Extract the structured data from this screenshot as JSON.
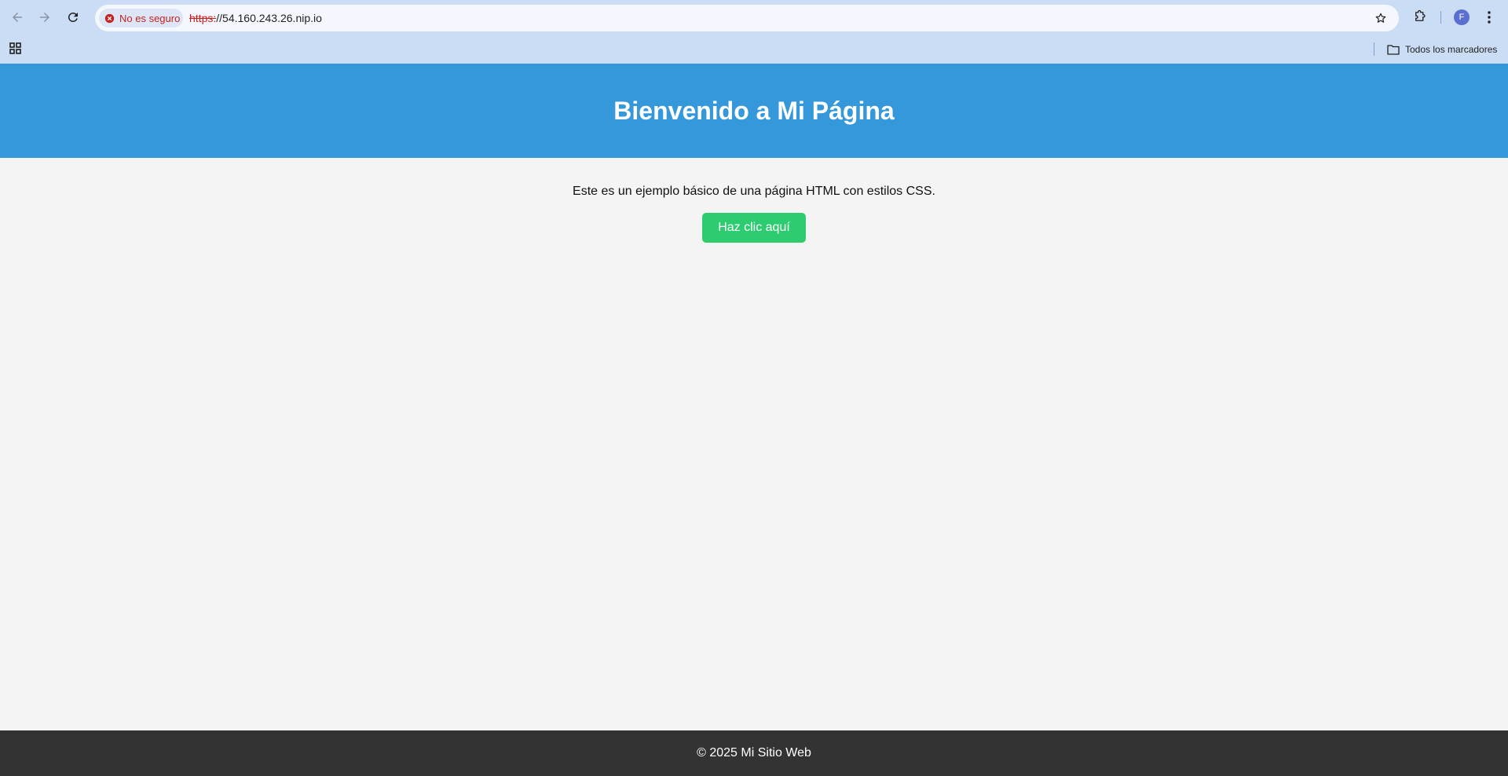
{
  "browser": {
    "security_chip": {
      "label": "No es seguro",
      "icon": "warning-circle-icon",
      "color": "#c5221f"
    },
    "url": {
      "scheme": "https:",
      "rest": "//54.160.243.26.nip.io"
    },
    "bookmarks": {
      "all_bookmarks_label": "Todos los marcadores"
    },
    "profile_initial": "F"
  },
  "page": {
    "header": {
      "title": "Bienvenido a Mi Página",
      "bg_color": "#3498db"
    },
    "intro_text": "Este es un ejemplo básico de una página HTML con estilos CSS.",
    "cta_button_label": "Haz clic aquí",
    "cta_color": "#2ecc71",
    "footer_text": "© 2025 Mi Sitio Web",
    "footer_bg": "#333333",
    "body_bg": "#f4f4f4"
  }
}
